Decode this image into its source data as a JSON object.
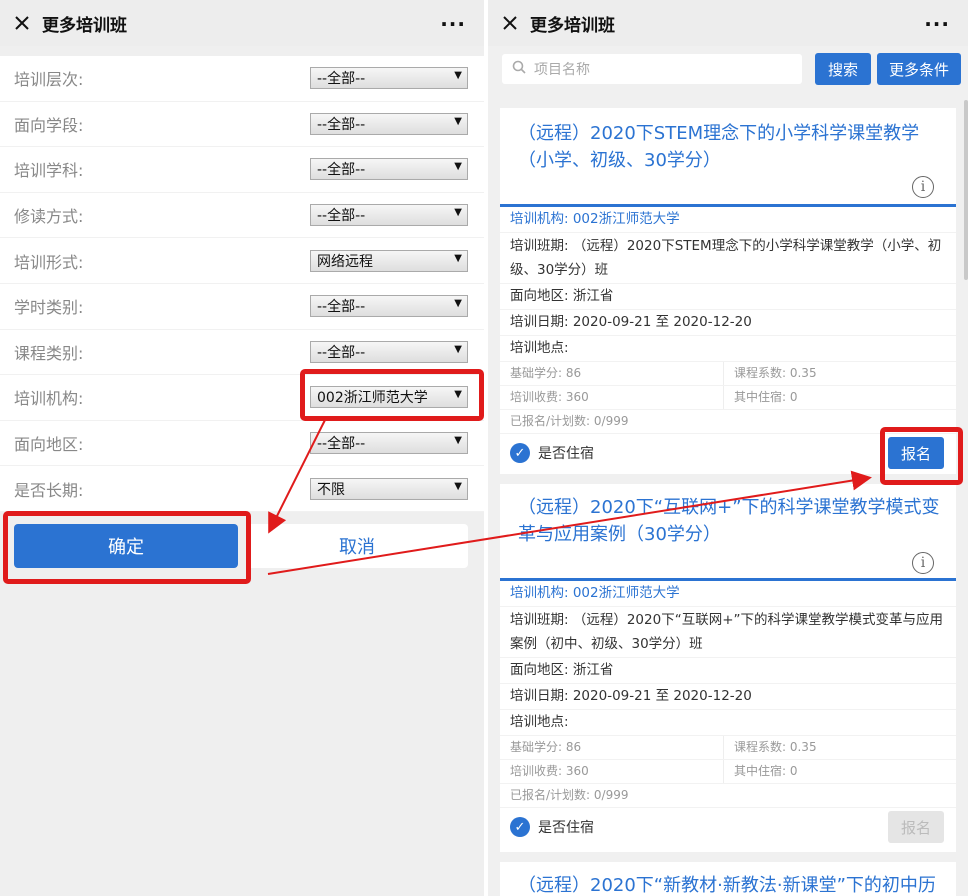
{
  "left": {
    "title": "更多培训班",
    "more": "···",
    "fields": [
      {
        "label": "培训层次:",
        "value": "--全部--"
      },
      {
        "label": "面向学段:",
        "value": "--全部--"
      },
      {
        "label": "培训学科:",
        "value": "--全部--"
      },
      {
        "label": "修读方式:",
        "value": "--全部--"
      },
      {
        "label": "培训形式:",
        "value": "网络远程"
      },
      {
        "label": "学时类别:",
        "value": "--全部--"
      },
      {
        "label": "课程类别:",
        "value": "--全部--"
      },
      {
        "label": "培训机构:",
        "value": "002浙江师范大学"
      },
      {
        "label": "面向地区:",
        "value": "--全部--"
      },
      {
        "label": "是否长期:",
        "value": "不限"
      }
    ],
    "ok_label": "确定",
    "cancel_label": "取消"
  },
  "right": {
    "title": "更多培训班",
    "more": "···",
    "search_placeholder": "项目名称",
    "search_label": "搜索",
    "more_filter_label": "更多条件",
    "cards": [
      {
        "title": "（远程）2020下STEM理念下的小学科学课堂教学（小学、初级、30学分）",
        "org": "培训机构: 002浙江师范大学",
        "class": "培训班期: （远程）2020下STEM理念下的小学科学课堂教学（小学、初级、30学分）班",
        "region": "面向地区: 浙江省",
        "dates": "培训日期: 2020-09-21 至 2020-12-20",
        "place": "培训地点:",
        "credit": "基础学分: 86",
        "coef": "课程系数: 0.35",
        "fee": "培训收费: 360",
        "lodging_fee": "其中住宿: 0",
        "enrolled": "已报名/计划数: 0/999",
        "lodging": "是否住宿",
        "sign": "报名"
      },
      {
        "title": "（远程）2020下“互联网+”下的科学课堂教学模式变革与应用案例（30学分）",
        "org": "培训机构: 002浙江师范大学",
        "class": "培训班期: （远程）2020下“互联网+”下的科学课堂教学模式变革与应用案例（初中、初级、30学分）班",
        "region": "面向地区: 浙江省",
        "dates": "培训日期: 2020-09-21 至 2020-12-20",
        "place": "培训地点:",
        "credit": "基础学分: 86",
        "coef": "课程系数: 0.35",
        "fee": "培训收费: 360",
        "lodging_fee": "其中住宿: 0",
        "enrolled": "已报名/计划数: 0/999",
        "lodging": "是否住宿",
        "sign": "报名"
      },
      {
        "title": "（远程）2020下“新教材·新教法·新课堂”下的初中历"
      }
    ]
  },
  "colors": {
    "accent": "#2b73d2",
    "highlight": "#e01b1b"
  }
}
